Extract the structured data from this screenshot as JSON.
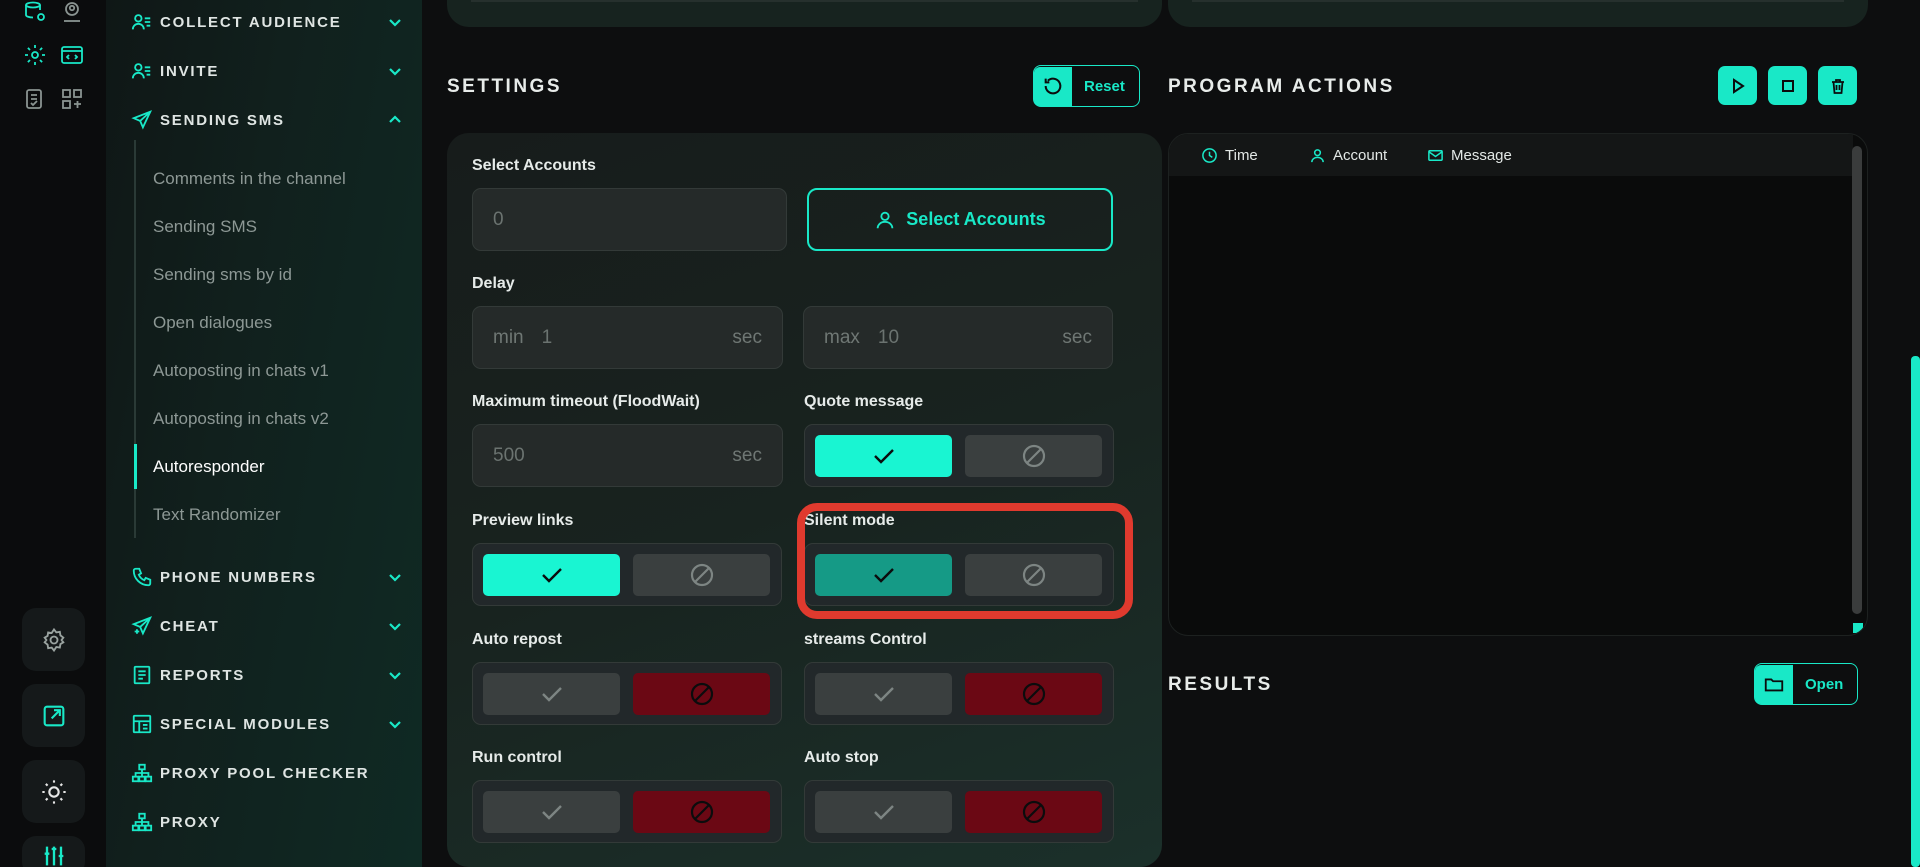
{
  "sidebar": {
    "headers": [
      {
        "label": "COLLECT AUDIENCE",
        "icon": "users-icon",
        "expanded": false
      },
      {
        "label": "INVITE",
        "icon": "user-list-icon",
        "expanded": false
      },
      {
        "label": "SENDING SMS",
        "icon": "paper-plane-icon",
        "expanded": true
      },
      {
        "label": "PHONE NUMBERS",
        "icon": "phone-icon",
        "expanded": false
      },
      {
        "label": "CHEAT",
        "icon": "send-plus-icon",
        "expanded": false
      },
      {
        "label": "REPORTS",
        "icon": "report-icon",
        "expanded": false
      },
      {
        "label": "SPECIAL MODULES",
        "icon": "module-icon",
        "expanded": false
      },
      {
        "label": "PROXY POOL CHECKER",
        "icon": "network-icon",
        "expanded": null
      },
      {
        "label": "PROXY",
        "icon": "network-icon",
        "expanded": null
      }
    ],
    "items": [
      {
        "label": "Comments in the channel"
      },
      {
        "label": "Sending SMS"
      },
      {
        "label": "Sending sms by id"
      },
      {
        "label": "Open dialogues"
      },
      {
        "label": "Autoposting in chats v1"
      },
      {
        "label": "Autoposting in chats v2"
      },
      {
        "label": "Autoresponder",
        "active": true
      },
      {
        "label": "Text Randomizer"
      }
    ]
  },
  "settings": {
    "title": "SETTINGS",
    "reset_label": "Reset",
    "select_accounts_label": "Select Accounts",
    "accounts_value": "0",
    "select_accounts_button": "Select Accounts",
    "delay_label": "Delay",
    "delay_min_prefix": "min",
    "delay_min_value": "1",
    "delay_max_prefix": "max",
    "delay_max_value": "10",
    "unit_sec": "sec",
    "floodwait_label": "Maximum timeout (FloodWait)",
    "floodwait_value": "500",
    "toggles": {
      "quote_message": {
        "label": "Quote message",
        "state": "on"
      },
      "preview_links": {
        "label": "Preview links",
        "state": "on"
      },
      "silent_mode": {
        "label": "Silent mode",
        "state": "on"
      },
      "auto_repost": {
        "label": "Auto repost",
        "state": "off"
      },
      "streams_control": {
        "label": "streams Control",
        "state": "off"
      },
      "run_control": {
        "label": "Run control",
        "state": "off"
      },
      "auto_stop": {
        "label": "Auto stop",
        "state": "off"
      }
    }
  },
  "program_actions": {
    "title": "PROGRAM ACTIONS",
    "columns": [
      "Time",
      "Account",
      "Message"
    ]
  },
  "results": {
    "title": "RESULTS",
    "open_label": "Open"
  },
  "colors": {
    "accent": "#19e8c7",
    "danger": "#6b0814",
    "highlight": "#e03a2e"
  }
}
